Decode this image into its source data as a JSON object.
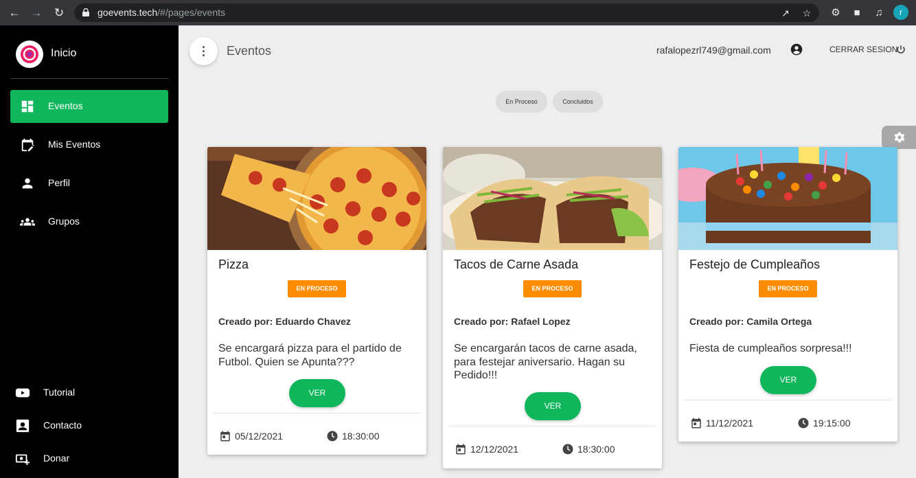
{
  "browser": {
    "url_host": "goevents.tech",
    "url_path": "/#/pages/events"
  },
  "sidebar": {
    "brand": "Inicio",
    "items": [
      {
        "label": "Eventos",
        "icon": "dashboard-icon",
        "active": true
      },
      {
        "label": "Mis Eventos",
        "icon": "edit-calendar-icon",
        "active": false
      },
      {
        "label": "Perfil",
        "icon": "person-icon",
        "active": false
      },
      {
        "label": "Grupos",
        "icon": "groups-icon",
        "active": false
      }
    ],
    "bottom": [
      {
        "label": "Tutorial",
        "icon": "youtube-icon"
      },
      {
        "label": "Contacto",
        "icon": "contact-icon"
      },
      {
        "label": "Donar",
        "icon": "donate-icon"
      }
    ]
  },
  "header": {
    "title": "Eventos",
    "email": "rafalopezrl749@gmail.com",
    "logout": "CERRAR SESION"
  },
  "filters": [
    "En Proceso",
    "Concluidos"
  ],
  "cards": [
    {
      "title": "Pizza",
      "status": "EN PROCESO",
      "creator": "Creado por: Eduardo Chavez",
      "description": "Se encargará pizza para el partido de Futbol. Quien se Apunta???",
      "button": "VER",
      "date": "05/12/2021",
      "time": "18:30:00"
    },
    {
      "title": "Tacos de Carne Asada",
      "status": "EN PROCESO",
      "creator": "Creado por: Rafael Lopez",
      "description": "Se encargarán tacos de carne asada, para festejar aniversario. Hagan su Pedido!!!",
      "button": "VER",
      "date": "12/12/2021",
      "time": "18:30:00"
    },
    {
      "title": "Festejo de Cumpleaños",
      "status": "EN PROCESO",
      "creator": "Creado por: Camila Ortega",
      "description": "Fiesta de cumpleaños sorpresa!!!",
      "button": "VER",
      "date": "11/12/2021",
      "time": "19:15:00"
    }
  ],
  "colors": {
    "accent": "#0fb65b",
    "status": "#fb8c00",
    "sidebar": "#000000"
  }
}
